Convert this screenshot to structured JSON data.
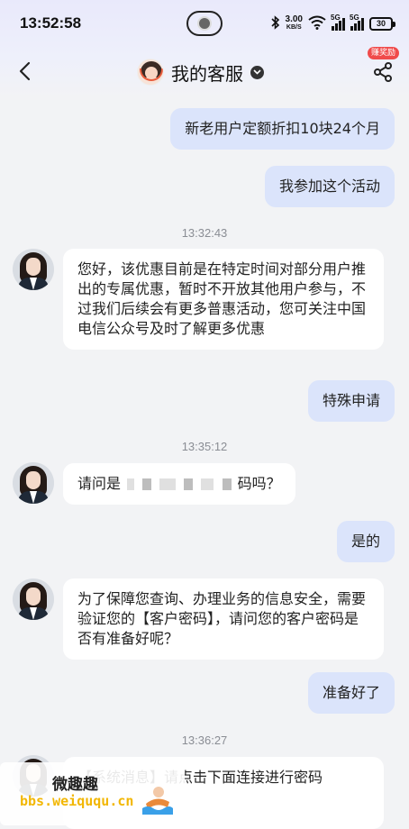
{
  "status_bar": {
    "time": "13:52:58",
    "net_speed": "3.00",
    "net_unit": "KB/S",
    "signal1": "5G",
    "signal2": "5G",
    "battery": "30"
  },
  "nav": {
    "title": "我的客服",
    "reward_badge": "赚奖励",
    "back_icon": "back-arrow-icon",
    "share_icon": "share-icon"
  },
  "messages": [
    {
      "from": "me",
      "text": "新老用户定额折扣10块24个月"
    },
    {
      "from": "me",
      "text": "我参加这个活动"
    },
    {
      "type": "time",
      "text": "13:32:43"
    },
    {
      "from": "cs",
      "text": "您好，该优惠目前是在特定时间对部分用户推出的专属优惠，暂时不开放其他用户参与，不过我们后续会有更多普惠活动，您可关注中国电信公众号及时了解更多优惠"
    },
    {
      "from": "me",
      "text": "特殊申请"
    },
    {
      "type": "time",
      "text": "13:35:12"
    },
    {
      "from": "cs",
      "prefix": "请问是",
      "suffix": "码吗？"
    },
    {
      "from": "me",
      "text": "是的"
    },
    {
      "from": "cs",
      "text": "为了保障您查询、办理业务的信息安全，需要验证您的【客户密码】，请问您的客户密码是否有准备好呢？"
    },
    {
      "from": "me",
      "text": "准备好了"
    },
    {
      "type": "time",
      "text": "13:36:27"
    },
    {
      "from": "cs",
      "text": "【系统消息】请点击下面连接进行密码"
    }
  ],
  "watermark": {
    "title": "微趣趣",
    "url": "bbs.weiququ.cn"
  },
  "colors": {
    "my_bubble": "#dbe4fb",
    "cs_bubble": "#ffffff",
    "background": "#f2f3f5",
    "badge": "#f04b4b",
    "watermark_url": "#f2b705"
  }
}
